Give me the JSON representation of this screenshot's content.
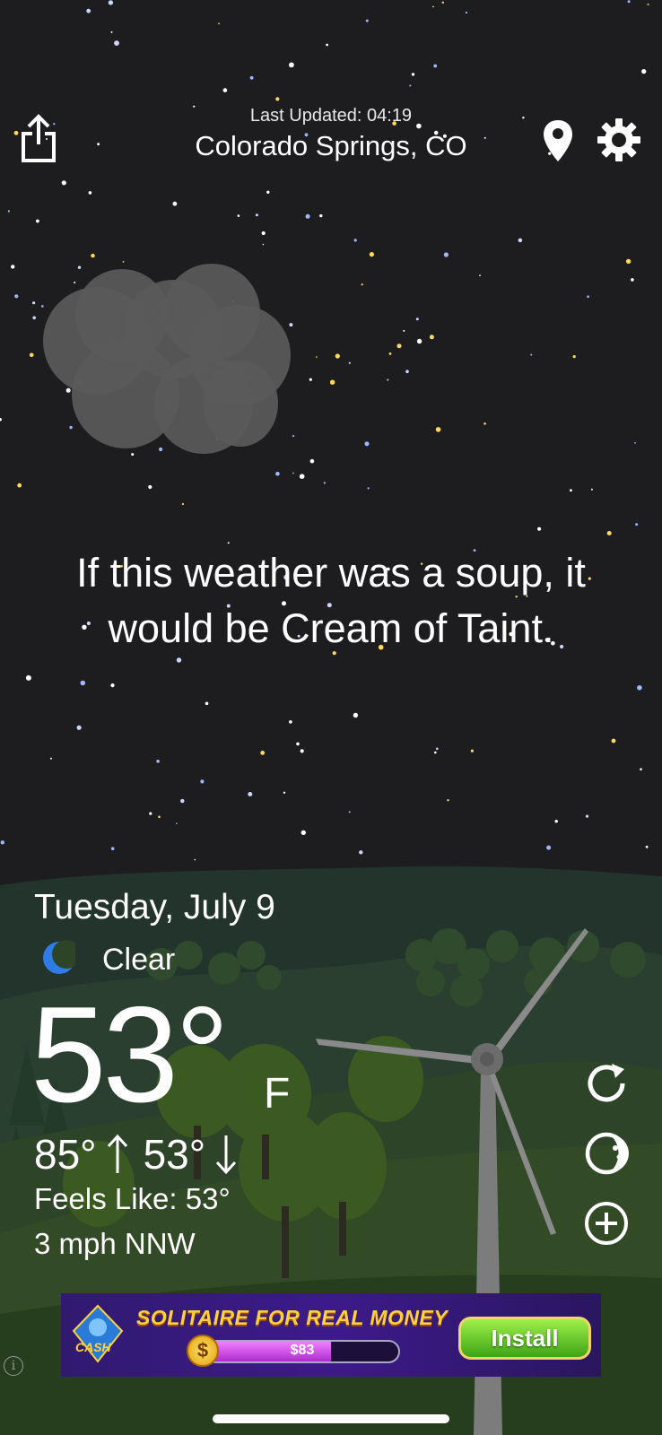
{
  "header": {
    "last_updated": "Last Updated: 04:19",
    "location": "Colorado Springs, CO",
    "share_icon": "share-icon",
    "location_icon": "location-pin-icon",
    "settings_icon": "gear-icon"
  },
  "quote": "If this weather was a soup, it would be Cream of Taint.",
  "weather": {
    "date": "Tuesday, July 9",
    "condition": "Clear",
    "condition_icon": "moon-icon",
    "temperature": "53°",
    "unit": "F",
    "high": "85°",
    "low": "53°",
    "feels_like": "Feels Like: 53°",
    "wind": "3 mph NNW"
  },
  "side_actions": {
    "refresh_icon": "refresh-icon",
    "moon_phase_icon": "moon-phase-icon",
    "add_icon": "add-circle-icon"
  },
  "ad": {
    "logo_text": "CASH",
    "title": "SOLITAIRE FOR REAL MONEY",
    "balance": "$83",
    "balance_fraction": 0.65,
    "install_label": "Install",
    "info_icon": "info-icon"
  },
  "colors": {
    "sky": "#1d1d1f",
    "moon_accent": "#2f7be8",
    "hill_far": "#26382f",
    "hill_near": "#344a2c"
  }
}
